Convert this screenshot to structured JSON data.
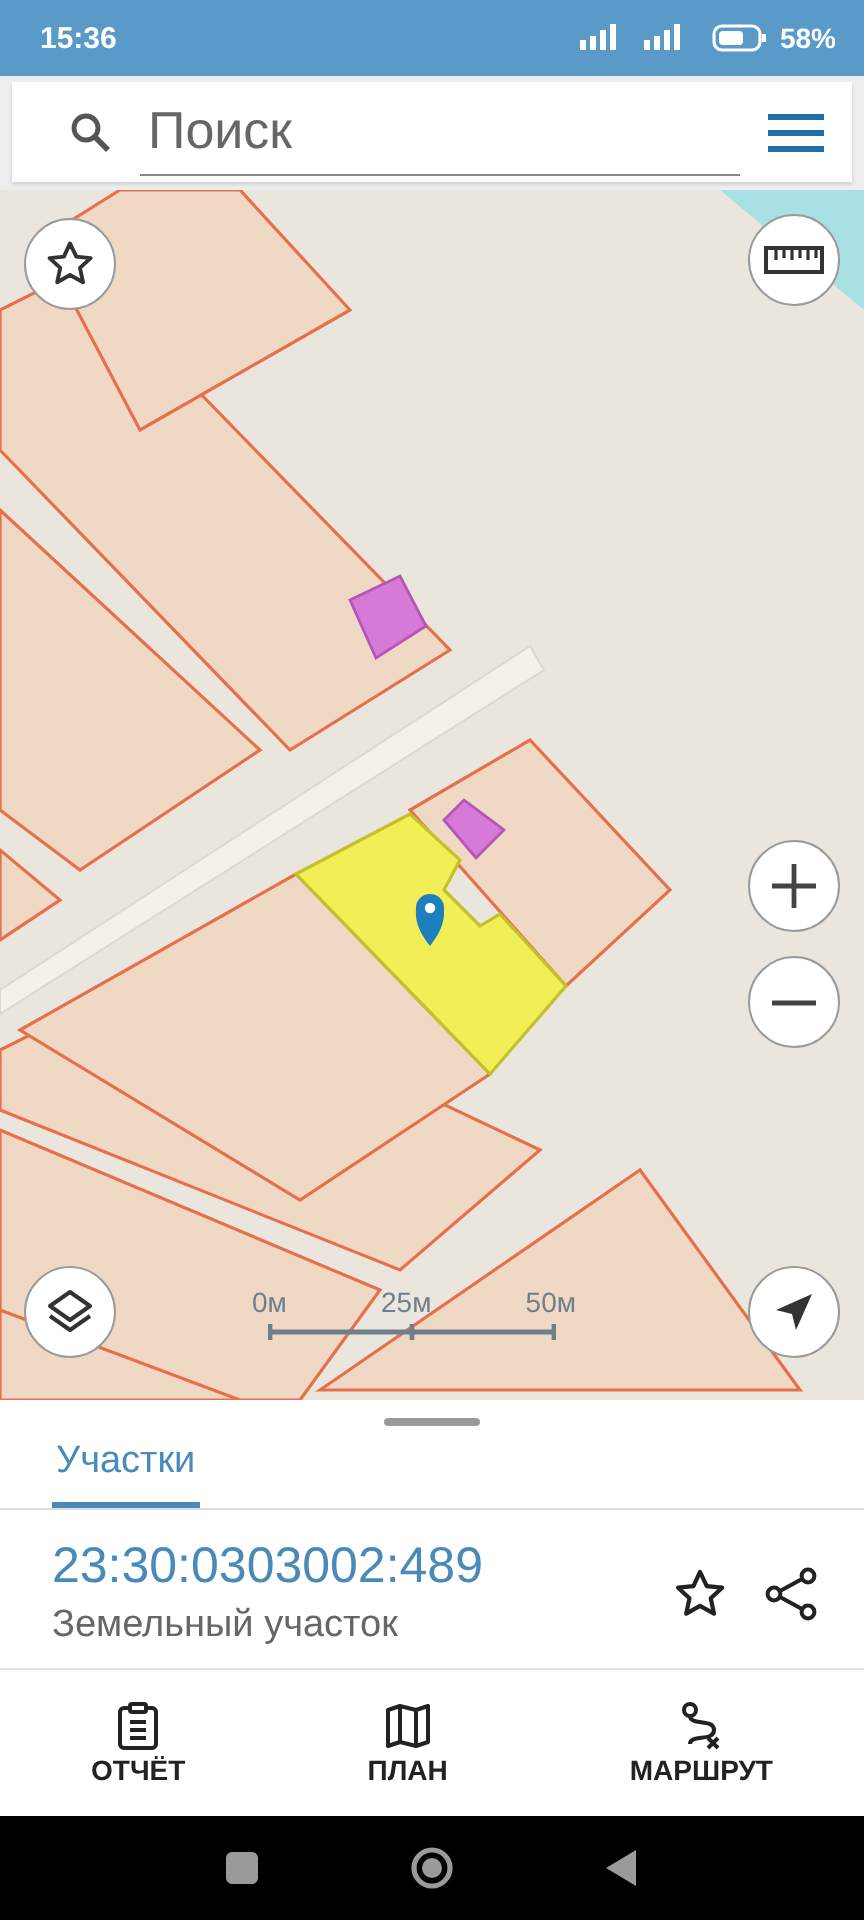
{
  "status_bar": {
    "time": "15:36",
    "battery": "58%"
  },
  "search": {
    "placeholder": "Поиск"
  },
  "map": {
    "scale_labels": [
      "0м",
      "25м",
      "50м"
    ]
  },
  "tabs": [
    {
      "label": "Участки",
      "selected": true
    }
  ],
  "parcel": {
    "number": "23:30:0303002:489",
    "type": "Земельный участок"
  },
  "actions": [
    {
      "kind": "report",
      "label": "ОТЧЁТ"
    },
    {
      "kind": "plan",
      "label": "ПЛАН"
    },
    {
      "kind": "route",
      "label": "МАРШРУТ"
    }
  ]
}
